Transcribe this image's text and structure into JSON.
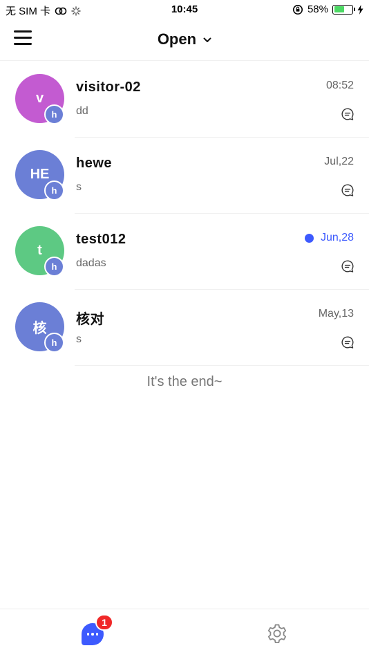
{
  "status_bar": {
    "carrier": "无 SIM 卡",
    "time": "10:45",
    "battery": "58%",
    "battery_level": 0.58
  },
  "header": {
    "title": "Open",
    "menu_icon": "menu-icon",
    "dropdown_icon": "chevron-down-icon"
  },
  "conversations": [
    {
      "initial": "v",
      "name": "visitor-02",
      "preview": "dd",
      "time": "08:52",
      "unread": false,
      "avatar_color": "#c35bd1",
      "badge": "h"
    },
    {
      "initial": "HE",
      "name": "hewe",
      "preview": "s",
      "time": "Jul,22",
      "unread": false,
      "avatar_color": "#6b7fd6",
      "badge": "h"
    },
    {
      "initial": "t",
      "name": "test012",
      "preview": "dadas",
      "time": "Jun,28",
      "unread": true,
      "avatar_color": "#5dc983",
      "badge": "h"
    },
    {
      "initial": "核",
      "name": "核对",
      "preview": "s",
      "time": "May,13",
      "unread": false,
      "avatar_color": "#6b7fd6",
      "badge": "h"
    }
  ],
  "end_text": "It's the end~",
  "tabbar": {
    "chats_badge": "1",
    "chats_icon": "chat-bubble-icon",
    "settings_icon": "gear-icon"
  },
  "colors": {
    "accent": "#3d5afe",
    "badge_red": "#f02828",
    "battery_green": "#4cd964"
  }
}
